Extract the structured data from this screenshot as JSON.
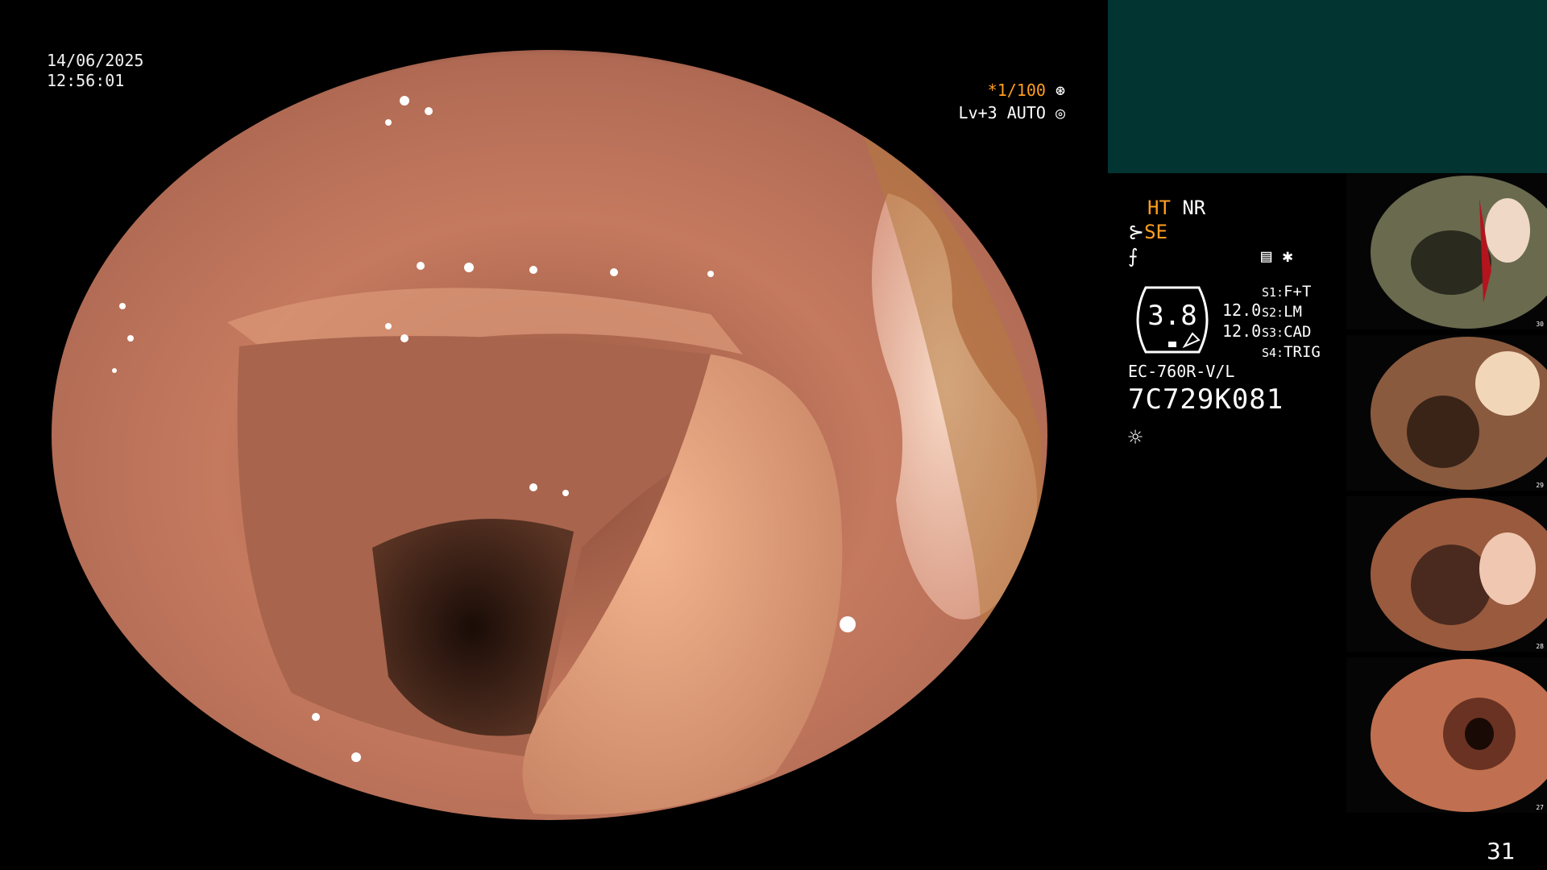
{
  "overlay": {
    "date": "14/06/2025",
    "time": "12:56:01",
    "shutter_speed": "*1/100",
    "level_mode": "Lv+3 AUTO"
  },
  "settings": {
    "ht": "HT",
    "nr": "NR",
    "se": "SE",
    "gauge_value": "3.8",
    "value_1": "12.0",
    "value_2": "12.0",
    "switches": [
      {
        "label": "S1:",
        "value": "F+T"
      },
      {
        "label": "S2:",
        "value": "LM"
      },
      {
        "label": "S3:",
        "value": "CAD"
      },
      {
        "label": "S4:",
        "value": "TRIG"
      }
    ],
    "scope_model": "EC-760R-V/L",
    "serial": "7C729K081"
  },
  "thumbnails": [
    {
      "index": "30"
    },
    {
      "index": "29"
    },
    {
      "index": "28"
    },
    {
      "index": "27"
    }
  ],
  "page_number": "31",
  "colors": {
    "accent_orange": "#ff9e1f",
    "panel_teal": "#023432",
    "tissue": "#c06f52"
  },
  "icons": [
    "shutter-icon",
    "auto-icon",
    "structure-icon",
    "freeze-icon",
    "capture-icon",
    "light-icon"
  ]
}
